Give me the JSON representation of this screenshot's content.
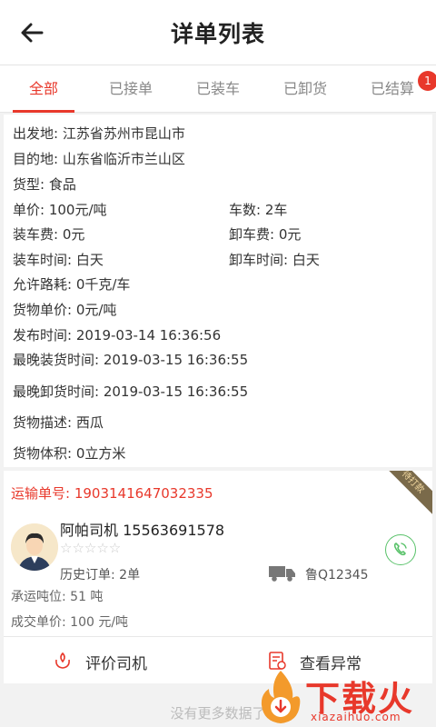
{
  "header": {
    "title": "详单列表"
  },
  "tabs": [
    {
      "label": "全部",
      "active": true
    },
    {
      "label": "已接单"
    },
    {
      "label": "已装车"
    },
    {
      "label": "已卸货"
    },
    {
      "label": "已结算",
      "badge": "1"
    }
  ],
  "details": {
    "origin": "出发地: 江苏省苏州市昆山市",
    "destination": "目的地: 山东省临沂市兰山区",
    "cargo_type": "货型: 食品",
    "unit_price": "单价: 100元/吨",
    "vehicles": "车数: 2车",
    "loading_fee": "装车费: 0元",
    "unloading_fee": "卸车费: 0元",
    "loading_time": "装车时间: 白天",
    "unloading_time": "卸车时间: 白天",
    "allowed_loss": "允许路耗: 0千克/车",
    "cargo_unit_price": "货物单价: 0元/吨",
    "publish_time": "发布时间: 2019-03-14 16:36:56",
    "latest_loading": "最晚装货时间: 2019-03-15 16:36:55",
    "latest_unloading": "最晚卸货时间: 2019-03-15 16:36:55",
    "description": "货物描述: 西瓜",
    "volume": "货物体积: 0立方米"
  },
  "transport": {
    "status_ribbon": "待打款",
    "order_no": "运输单号: 1903141647032335",
    "driver": "阿帕司机 15563691578",
    "stars": "☆☆☆☆☆",
    "history": "历史订单: 2单",
    "plate": "鲁Q12345",
    "tonnage": "承运吨位: 51 吨",
    "deal_price": "成交单价: 100 元/吨",
    "rate_label": "评价司机",
    "exception_label": "查看异常"
  },
  "footer": {
    "text": "没有更多数据了"
  },
  "watermark": {
    "text": "下载火",
    "sub": "xiazaihuo.com"
  },
  "colors": {
    "accent": "#e8382b",
    "phone": "#59c26a"
  },
  "icons": [
    "back-arrow-icon",
    "phone-icon",
    "truck-icon",
    "rate-driver-icon",
    "exception-icon"
  ]
}
